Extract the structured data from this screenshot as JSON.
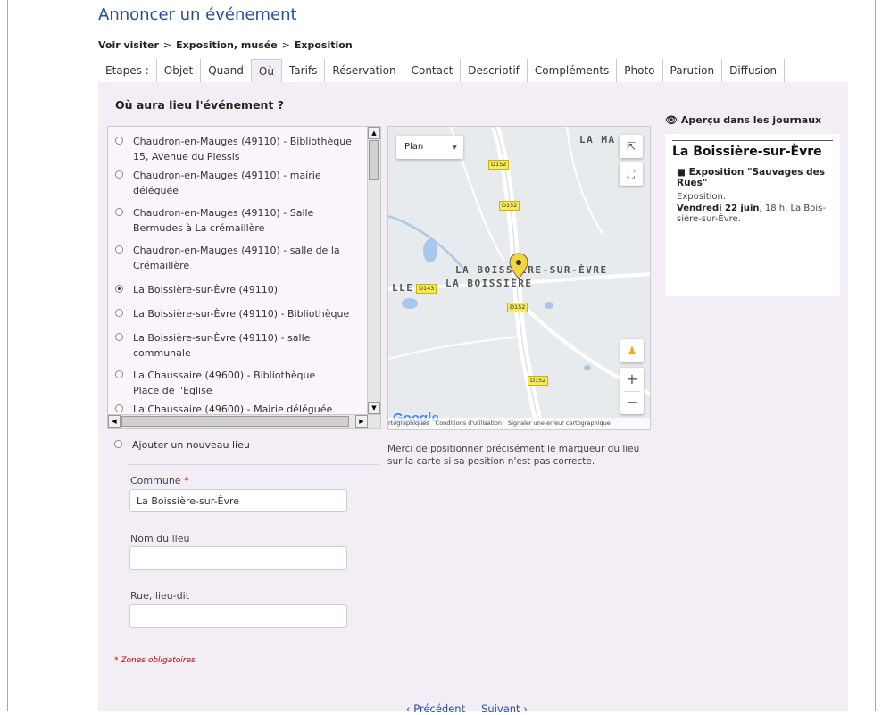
{
  "title": "Annoncer un événement",
  "breadcrumb": {
    "items": [
      "Voir visiter",
      "Exposition, musée",
      "Exposition"
    ],
    "separator": ">"
  },
  "tabs": {
    "label": "Etapes :",
    "items": [
      "Objet",
      "Quand",
      "Où",
      "Tarifs",
      "Réservation",
      "Contact",
      "Descriptif",
      "Compléments",
      "Photo",
      "Parution",
      "Diffusion"
    ],
    "active": "Où"
  },
  "question": "Où aura lieu l'événement ?",
  "places": [
    {
      "line1": "Chaudron-en-Mauges (49110) - Bibliothèque",
      "line2": "15, Avenue du Plessis",
      "checked": false
    },
    {
      "line1": "Chaudron-en-Mauges (49110) - mairie",
      "line2": "déléguée",
      "checked": false
    },
    {
      "line1": "Chaudron-en-Mauges (49110) - Salle",
      "line2": "Bermudes à La crémaillère",
      "checked": false
    },
    {
      "line1": "Chaudron-en-Mauges (49110) - salle de la",
      "line2": "Crémaillère",
      "checked": false
    },
    {
      "line1": "La Boissière-sur-Èvre (49110)",
      "line2": "",
      "checked": true
    },
    {
      "line1": "La Boissière-sur-Èvre (49110) - Bibliothèque",
      "line2": "",
      "checked": false
    },
    {
      "line1": "La Boissière-sur-Èvre (49110) - salle",
      "line2": "communale",
      "checked": false
    },
    {
      "line1": "La Chaussaire (49600) - Bibliothèque",
      "line2": "Place de l'Eglise",
      "checked": false
    },
    {
      "line1": "La Chaussaire (49600) - Mairie déléguée",
      "line2": "",
      "checked": false
    }
  ],
  "add_place": "Ajouter un nouveau lieu",
  "form": {
    "commune_label": "Commune",
    "required_mark": "*",
    "commune_value": "La Boissière-sur-Èvre",
    "lieu_label": "Nom du lieu",
    "lieu_value": "",
    "rue_label": "Rue, lieu-dit",
    "rue_value": "",
    "required_note": "* Zones obligatoires"
  },
  "map": {
    "type_select": "Plan",
    "labels": {
      "top_right": "LA MA",
      "town1": "LA BOISSIÈRE-SUR-ÈVRE",
      "town2": "LA BOISSIÈRE",
      "left": "LLE"
    },
    "roads": [
      "D152",
      "D152",
      "D143",
      "D152",
      "D152"
    ],
    "logo": "Google",
    "footer": [
      "rtographiques",
      "Conditions d'utilisation",
      "Signaler une erreur cartographique"
    ],
    "colors": {
      "water": "#a9c7eb",
      "land": "#e8ebee",
      "road": "#ffffff",
      "pin": "#f5d43c"
    }
  },
  "map_note": "Merci de positionner précisément le marqueur du lieu sur la carte si sa position n'est pas correcte.",
  "preview": {
    "heading": "Aperçu dans les journaux",
    "town": "La Boissière-sur-Èvre",
    "event": "Exposition \"Sauvages des Rues\"",
    "category": "Exposition.",
    "date_bold": "Vendredi 22 juin",
    "date_rest": ", 18 h, La Bois-sière-sur-Èvre."
  },
  "pager": {
    "prev": "‹ Précédent",
    "next": "Suivant ›"
  }
}
